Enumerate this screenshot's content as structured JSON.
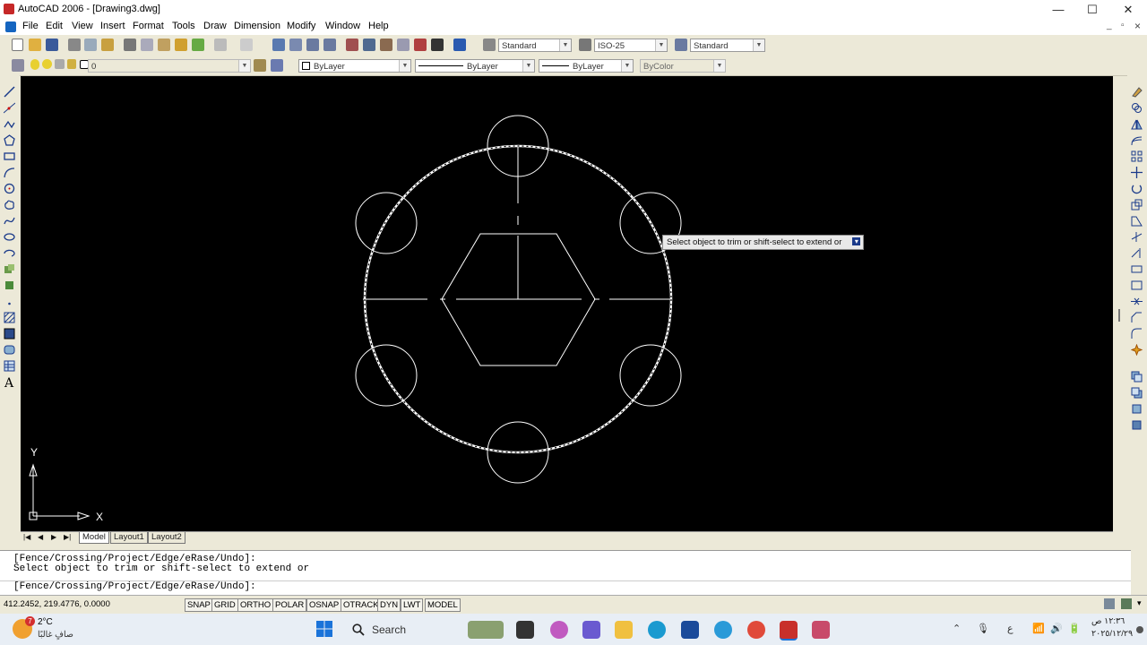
{
  "window": {
    "title": "AutoCAD 2006 - [Drawing3.dwg]",
    "controls": {
      "minimize": "—",
      "maximize": "☐",
      "close": "✕"
    },
    "doc_controls": {
      "minimize": "_",
      "restore": "▫",
      "close": "×"
    }
  },
  "menu": [
    "File",
    "Edit",
    "View",
    "Insert",
    "Format",
    "Tools",
    "Draw",
    "Dimension",
    "Modify",
    "Window",
    "Help"
  ],
  "styles_toolbar": {
    "text_style": "Standard",
    "dim_style": "ISO-25",
    "table_style": "Standard"
  },
  "layers_toolbar": {
    "current_layer": "0",
    "color": "ByLayer",
    "linetype": "ByLayer",
    "lineweight": "ByLayer",
    "plot_style": "ByColor"
  },
  "canvas": {
    "tooltip": "Select object to trim or shift-select to extend or",
    "ucs_x": "X",
    "ucs_y": "Y"
  },
  "tabs": [
    {
      "label": "Model"
    },
    {
      "label": "Layout1"
    },
    {
      "label": "Layout2"
    }
  ],
  "command": {
    "history_1": "[Fence/Crossing/Project/Edge/eRase/Undo]:",
    "history_2": "Select object to trim or shift-select to extend or",
    "current": "[Fence/Crossing/Project/Edge/eRase/Undo]:"
  },
  "status": {
    "coordinates": "412.2452, 219.4776, 0.0000",
    "toggles": [
      "SNAP",
      "GRID",
      "ORTHO",
      "POLAR",
      "OSNAP",
      "OTRACK",
      "DYN",
      "LWT",
      "MODEL"
    ]
  },
  "taskbar": {
    "weather_badge": "7",
    "temperature": "2°C",
    "weather_text": "صافٍ غالبًا",
    "search_label": "Search",
    "language": "ع",
    "time": "١٢:٣٦ ص",
    "date": "٢٠٢٥/١٢/٢٩"
  }
}
